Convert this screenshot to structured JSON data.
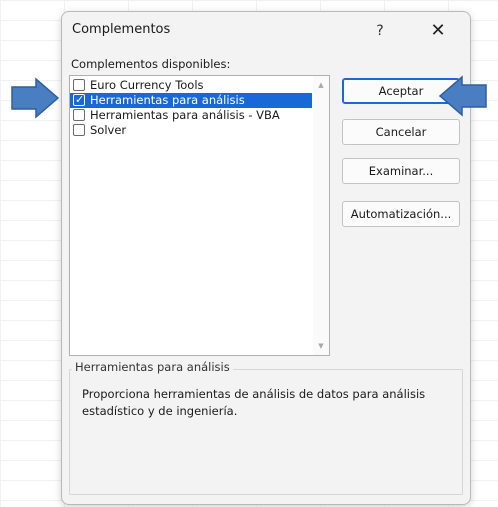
{
  "dialog": {
    "title": "Complementos",
    "help_label": "?",
    "close_label": "✕"
  },
  "addins": {
    "label": "Complementos disponibles:",
    "items": [
      {
        "label": "Euro Currency Tools",
        "checked": false,
        "selected": false
      },
      {
        "label": "Herramientas para análisis",
        "checked": true,
        "selected": true
      },
      {
        "label": "Herramientas para análisis - VBA",
        "checked": false,
        "selected": false
      },
      {
        "label": "Solver",
        "checked": false,
        "selected": false
      }
    ]
  },
  "buttons": {
    "ok": "Aceptar",
    "cancel": "Cancelar",
    "browse": "Examinar...",
    "automation": "Automatización..."
  },
  "description": {
    "title": "Herramientas para análisis",
    "text": "Proporciona herramientas de análisis de datos para análisis estadístico y de ingeniería."
  },
  "colors": {
    "selection": "#1769d6",
    "arrow_fill": "#4a7ec2",
    "arrow_stroke": "#2f5f9e"
  }
}
